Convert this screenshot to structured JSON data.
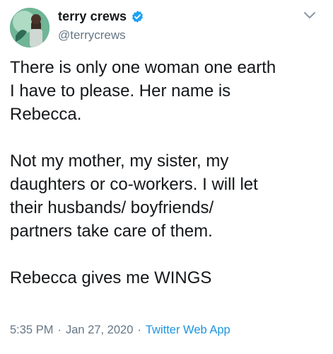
{
  "author": {
    "display_name": "terry crews",
    "handle": "@terrycrews",
    "avatar_icon": "profile-avatar",
    "verified_icon": "verified-badge-icon",
    "verified_color": "#1da1f2"
  },
  "tweet": {
    "paragraphs": [
      [
        "There is only one woman one earth",
        "I have to please. Her name is",
        "Rebecca."
      ],
      [
        "Not my mother, my sister, my",
        "daughters or co-workers. I will let",
        "their husbands/ boyfriends/",
        "partners take care of them."
      ],
      [
        "Rebecca gives me WINGS"
      ]
    ]
  },
  "meta": {
    "time": "5:35 PM",
    "separator": "·",
    "date": "Jan 27, 2020",
    "source": "Twitter Web App",
    "source_color": "#1b95e0"
  },
  "controls": {
    "menu_icon": "chevron-down-icon"
  }
}
